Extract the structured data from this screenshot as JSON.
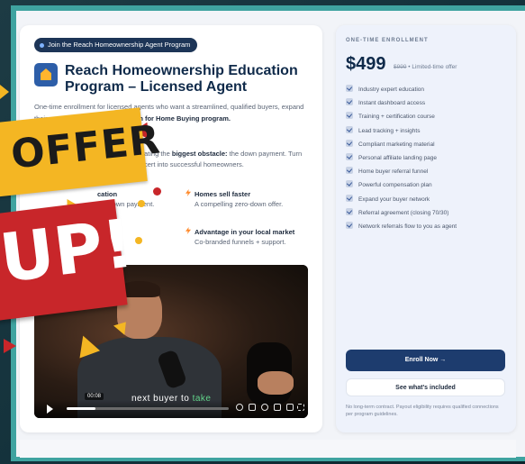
{
  "page": {
    "pill_label": "Join the Reach Homeownership Agent Program",
    "title": "Reach Homeownership Education Program – Licensed Agent",
    "description_lead": "One-time enrollment",
    "description_rest": "for licensed agents who want a streamlined, qualified buyers, expand their network, and close more",
    "description_bold": "Down for Home Buying program.",
    "obstacle_lead": "ating the",
    "obstacle_bold": "biggest obstacle:",
    "obstacle_rest": "the down payment. Turn cert into successful homeowners."
  },
  "mini_cards": {
    "left_top_head": "cation",
    "left_top_body": "the down payment.",
    "homes_head": "Homes sell faster",
    "homes_body": "A compelling zero-down offer.",
    "advantage_head": "Advantage in your local market",
    "advantage_body": "Co-branded funnels + support."
  },
  "overlay": {
    "offer_text": "OFFER",
    "up_text": "UP!"
  },
  "video": {
    "caption_white": "next buyer to",
    "caption_green": "take",
    "time_chip": "00:08",
    "progress": 0.18
  },
  "pricing": {
    "label": "ONE-TIME ENROLLMENT",
    "price": "$499",
    "old_price": "$999",
    "note": "• Limited-time offer",
    "features": [
      "Industry expert education",
      "Instant dashboard access",
      "Training + certification course",
      "Lead tracking + insights",
      "Compliant marketing material",
      "Personal affiliate landing page",
      "Home buyer referral funnel",
      "Powerful compensation plan",
      "Expand your buyer network",
      "Referral agreement (closing 70/30)",
      "Network referrals flow to you as agent"
    ],
    "enroll_button": "Enroll Now →",
    "included_button": "See what's included",
    "fineprint": "No long-term contract. Payout eligibility requires qualified connections per program guidelines."
  },
  "colors": {
    "navy": "#1d3c6e",
    "offer_yellow": "#f4b623",
    "up_red": "#c8262a",
    "teal_border": "#3fa3a0"
  }
}
